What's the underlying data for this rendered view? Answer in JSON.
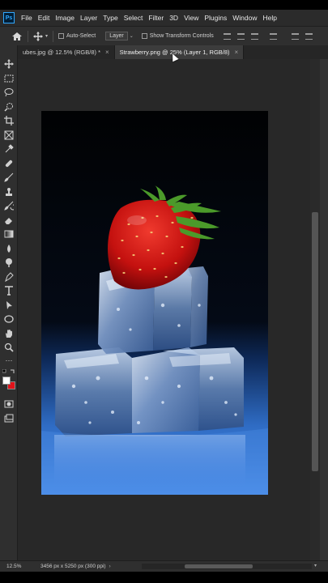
{
  "app": {
    "logo_text": "Ps"
  },
  "menu": [
    "File",
    "Edit",
    "Image",
    "Layer",
    "Type",
    "Select",
    "Filter",
    "3D",
    "View",
    "Plugins",
    "Window",
    "Help"
  ],
  "options": {
    "home_icon": "home-icon",
    "move_icon": "move-tool-icon",
    "auto_select_label": "Auto-Select",
    "auto_select_value": "Layer",
    "show_transform_label": "Show Transform Controls"
  },
  "tabs": [
    {
      "label": "ubes.jpg @ 12.5% (RGB/8) *",
      "active": false
    },
    {
      "label": "Strawberry.png @ 25% (Layer 1, RGB/8)",
      "active": true
    }
  ],
  "tools": [
    "move-tool-icon",
    "marquee-tool-icon",
    "lasso-tool-icon",
    "quick-select-icon",
    "crop-tool-icon",
    "frame-tool-icon",
    "eyedropper-icon",
    "healing-brush-icon",
    "brush-tool-icon",
    "clone-stamp-icon",
    "history-brush-icon",
    "eraser-icon",
    "gradient-tool-icon",
    "blur-tool-icon",
    "dodge-tool-icon",
    "pen-tool-icon",
    "type-tool-icon",
    "path-select-icon",
    "ellipse-tool-icon",
    "hand-tool-icon",
    "zoom-tool-icon",
    "more-tools-icon",
    "swap-colors-icon",
    "color-swatch-icon",
    "quick-mask-icon",
    "screen-mode-icon"
  ],
  "colors": {
    "foreground": "#ffffff",
    "background": "#e0131a"
  },
  "status": {
    "zoom": "12.5%",
    "doc_info": "3456 px x 5250 px (300 ppi)"
  },
  "image": {
    "content": "Strawberry on ice cubes"
  }
}
